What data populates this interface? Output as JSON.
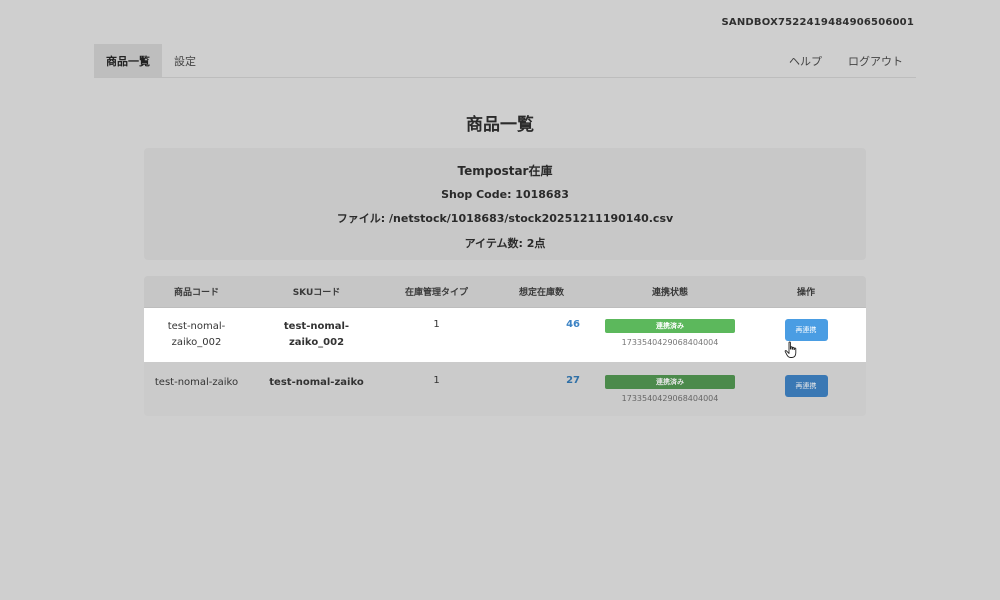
{
  "header": {
    "account_id": "SANDBOX7522419484906506001"
  },
  "nav": {
    "tabs": [
      {
        "label": "商品一覧"
      },
      {
        "label": "設定"
      }
    ],
    "help_label": "ヘルプ",
    "logout_label": "ログアウト"
  },
  "page": {
    "title": "商品一覧"
  },
  "info": {
    "title": "Tempostar在庫",
    "shop_code": "Shop Code: 1018683",
    "file": "ファイル: /netstock/1018683/stock20251211190140.csv",
    "items": "アイテム数: 2点"
  },
  "table": {
    "headers": [
      "商品コード",
      "SKUコード",
      "在庫管理タイプ",
      "想定在庫数",
      "連携状態",
      "操作"
    ],
    "rows": [
      {
        "product_code_1": "test-nomal-",
        "product_code_2": "zaiko_002",
        "sku_code_1": "test-nomal-",
        "sku_code_2": "zaiko_002",
        "stock_type": "1",
        "stock_count": "46",
        "status_label": "連携済み",
        "status_id": "1733540429068404004",
        "action_label": "再連携"
      },
      {
        "product_code_1": "test-nomal-zaiko",
        "sku_code_1": "test-nomal-zaiko",
        "stock_type": "1",
        "stock_count": "27",
        "status_label": "連携済み",
        "status_id": "1733540429068404004",
        "action_label": "再連携"
      }
    ]
  },
  "colors": {
    "accent_blue": "#4a9de3",
    "status_green": "#5cb85c",
    "stock_blue": "#3b82c4"
  }
}
